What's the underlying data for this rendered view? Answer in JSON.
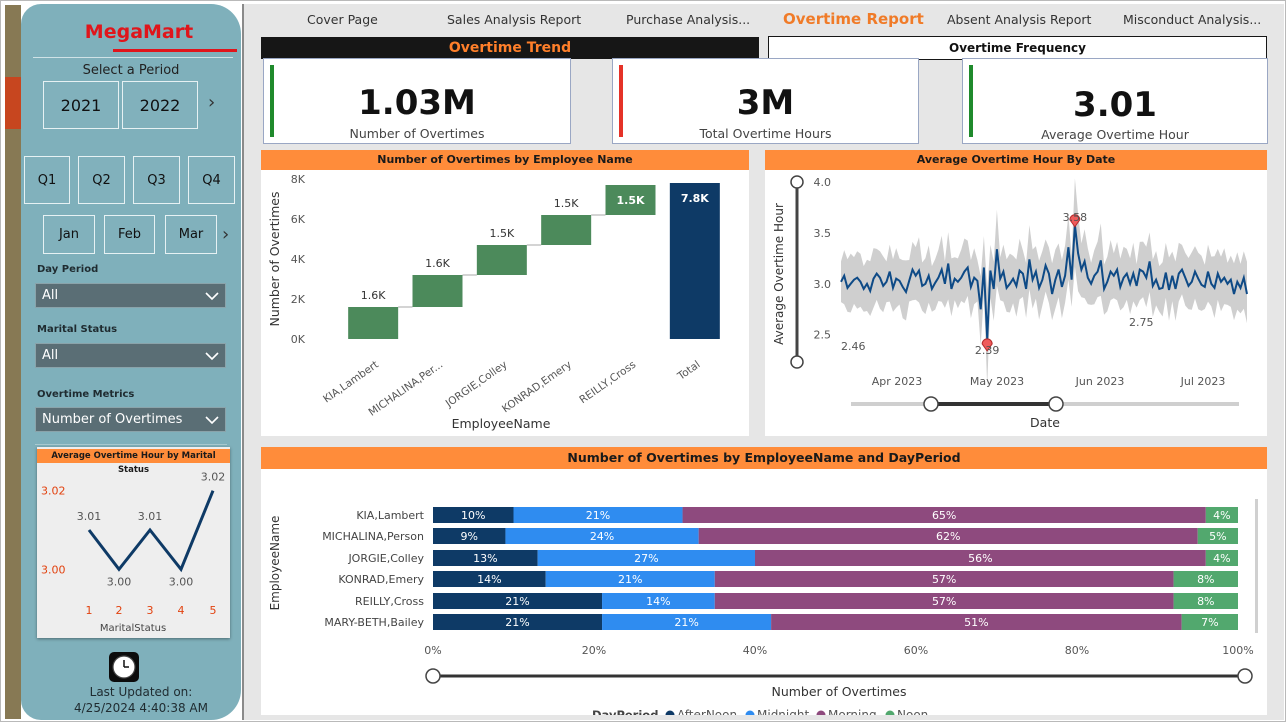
{
  "brand": "MegaMart",
  "sidebar": {
    "select_period": "Select a Period",
    "years": [
      "2021",
      "2022"
    ],
    "quarters": [
      "Q1",
      "Q2",
      "Q3",
      "Q4"
    ],
    "months": [
      "Jan",
      "Feb",
      "Mar"
    ],
    "filters": {
      "day_period": {
        "label": "Day Period",
        "value": "All"
      },
      "marital_status": {
        "label": "Marital Status",
        "value": "All"
      },
      "overtime_metrics": {
        "label": "Overtime Metrics",
        "value": "Number of Overtimes"
      }
    },
    "last_updated_label": "Last Updated on:",
    "last_updated_value": "4/25/2024 4:40:38 AM"
  },
  "nav": {
    "items": [
      "Cover Page",
      "Sales Analysis Report",
      "Purchase Analysis...",
      "Overtime Report",
      "Absent Analysis Report",
      "Misconduct Analysis..."
    ],
    "active": "Overtime Report"
  },
  "tabs": {
    "trend": "Overtime Trend",
    "frequency": "Overtime Frequency"
  },
  "kpis": [
    {
      "value": "1.03M",
      "label": "Number of Overtimes",
      "accent": "#1f8a2c"
    },
    {
      "value": "3M",
      "label": "Total Overtime Hours",
      "accent": "#e53228"
    },
    {
      "value": "3.01",
      "label": "Average Overtime Hour",
      "accent": "#1f8a2c"
    }
  ],
  "colors": {
    "accent": "#ff8c3a",
    "increase": "#4c8a5b",
    "total": "#0e3a66",
    "afternoon": "#0e3a66",
    "midnight": "#2f8cf0",
    "morning": "#8e4a7e",
    "noon": "#52a86e"
  },
  "mini_chart": {
    "title": "Average Overtime Hour by Marital Status",
    "xlabel": "MaritalStatus",
    "y_ticks": [
      "3.02",
      "3.00"
    ]
  },
  "chart_data": [
    {
      "type": "bar",
      "subtype": "waterfall",
      "title": "Number of Overtimes by Employee Name",
      "xlabel": "EmployeeName",
      "ylabel": "Number of Overtimes",
      "ylim": [
        0,
        8000
      ],
      "y_ticks": [
        "0K",
        "2K",
        "4K",
        "6K",
        "8K"
      ],
      "categories": [
        "KIA,Lambert",
        "MICHALINA,Per...",
        "JORGIE,Colley",
        "KONRAD,Emery",
        "REILLY,Cross",
        "Total"
      ],
      "values": [
        1600,
        1600,
        1500,
        1500,
        1500,
        7800
      ],
      "data_labels": [
        "1.6K",
        "1.6K",
        "1.5K",
        "1.5K",
        "1.5K",
        "7.8K"
      ]
    },
    {
      "type": "line",
      "title": "Average Overtime Hour By Date",
      "xlabel": "Date",
      "ylabel": "Average Overtime Hour",
      "ylim": [
        2.35,
        4.0
      ],
      "y_ticks": [
        "2.5",
        "3.0",
        "3.5",
        "4.0"
      ],
      "x_ticks": [
        "Apr 2023",
        "May 2023",
        "Jun 2023",
        "Jul 2023"
      ],
      "x": [
        "2023-03-20",
        "2023-07-31"
      ],
      "series": [
        {
          "values": [
            3.02,
            3.08,
            2.96,
            3.0,
            3.04,
            3.06,
            3.02,
            2.95,
            3.0,
            2.93,
            3.05,
            3.1,
            3.06,
            2.98,
            3.02,
            3.12,
            2.96,
            3.05,
            3.03,
            2.97,
            2.92,
            3.03,
            3.14,
            3.08,
            3.13,
            2.98,
            3.0,
            3.08,
            2.95,
            3.01,
            3.06,
            3.14,
            3.0,
            3.2,
            2.95,
            3.05,
            3.02,
            3.06,
            3.12,
            3.16,
            2.97,
            3.06,
            3.03,
            2.75,
            3.16,
            2.46,
            3.13,
            2.95,
            3.34,
            3.05,
            3.12,
            2.96,
            3.0,
            3.05,
            2.98,
            3.13,
            3.1,
            2.95,
            3.24,
            3.04,
            3.12,
            2.96,
            3.04,
            3.18,
            3.1,
            2.9,
            3.04,
            3.14,
            2.97,
            3.08,
            3.36,
            3.04,
            3.58,
            3.3,
            3.14,
            3.22,
            3.06,
            3.0,
            3.08,
            3.12,
            3.23,
            2.95,
            3.02,
            3.12,
            3.08,
            3.14,
            2.97,
            3.06,
            3.1,
            3.0,
            3.1,
            2.98,
            3.14,
            3.12,
            3.06,
            3.22,
            2.98,
            3.04,
            2.95,
            2.96,
            3.11,
            2.94,
            3.08,
            2.95,
            3.1,
            3.14,
            3.06,
            2.98,
            3.02,
            3.12,
            3.05,
            2.99,
            2.97,
            3.12,
            3.0,
            2.96,
            3.1,
            3.02,
            3.06,
            3.0,
            3.04,
            2.9,
            3.02,
            2.96,
            3.06,
            2.9
          ]
        }
      ],
      "annotations": [
        {
          "text": "3.58",
          "kind": "max"
        },
        {
          "text": "2.39",
          "kind": "min"
        },
        {
          "text": "2.46"
        },
        {
          "text": "2.75"
        }
      ]
    },
    {
      "type": "bar",
      "subtype": "stacked-100-horizontal",
      "title": "Number of Overtimes by EmployeeName and DayPeriod",
      "xlabel": "Number of Overtimes",
      "ylabel": "EmployeeName",
      "x_ticks": [
        "0%",
        "20%",
        "40%",
        "60%",
        "80%",
        "100%"
      ],
      "legend_title": "DayPeriod",
      "legend_position": "bottom",
      "categories": [
        "KIA,Lambert",
        "MICHALINA,Person",
        "JORGIE,Colley",
        "KONRAD,Emery",
        "REILLY,Cross",
        "MARY-BETH,Bailey"
      ],
      "series": [
        {
          "name": "AfterNoon",
          "values": [
            10,
            9,
            13,
            14,
            21,
            21
          ],
          "labels": [
            "10%",
            "9%",
            "13%",
            "14%",
            "21%",
            "21%"
          ]
        },
        {
          "name": "Midnight",
          "values": [
            21,
            24,
            27,
            21,
            14,
            21
          ],
          "labels": [
            "21%",
            "24%",
            "27%",
            "21%",
            "14%",
            "21%"
          ]
        },
        {
          "name": "Morning",
          "values": [
            65,
            62,
            56,
            57,
            57,
            51
          ],
          "labels": [
            "65%",
            "62%",
            "56%",
            "57%",
            "57%",
            "51%"
          ]
        },
        {
          "name": "Noon",
          "values": [
            4,
            5,
            4,
            8,
            8,
            7
          ],
          "labels": [
            "4%",
            "5%",
            "4%",
            "8%",
            "8%",
            "7%"
          ]
        }
      ]
    },
    {
      "type": "line",
      "title": "Average Overtime Hour by Marital Status",
      "xlabel": "MaritalStatus",
      "categories": [
        "1",
        "2",
        "3",
        "4",
        "5"
      ],
      "values": [
        3.01,
        3.0,
        3.01,
        3.0,
        3.02
      ],
      "data_labels": [
        "3.01",
        "3.00",
        "3.01",
        "3.00",
        "3.02"
      ]
    }
  ]
}
